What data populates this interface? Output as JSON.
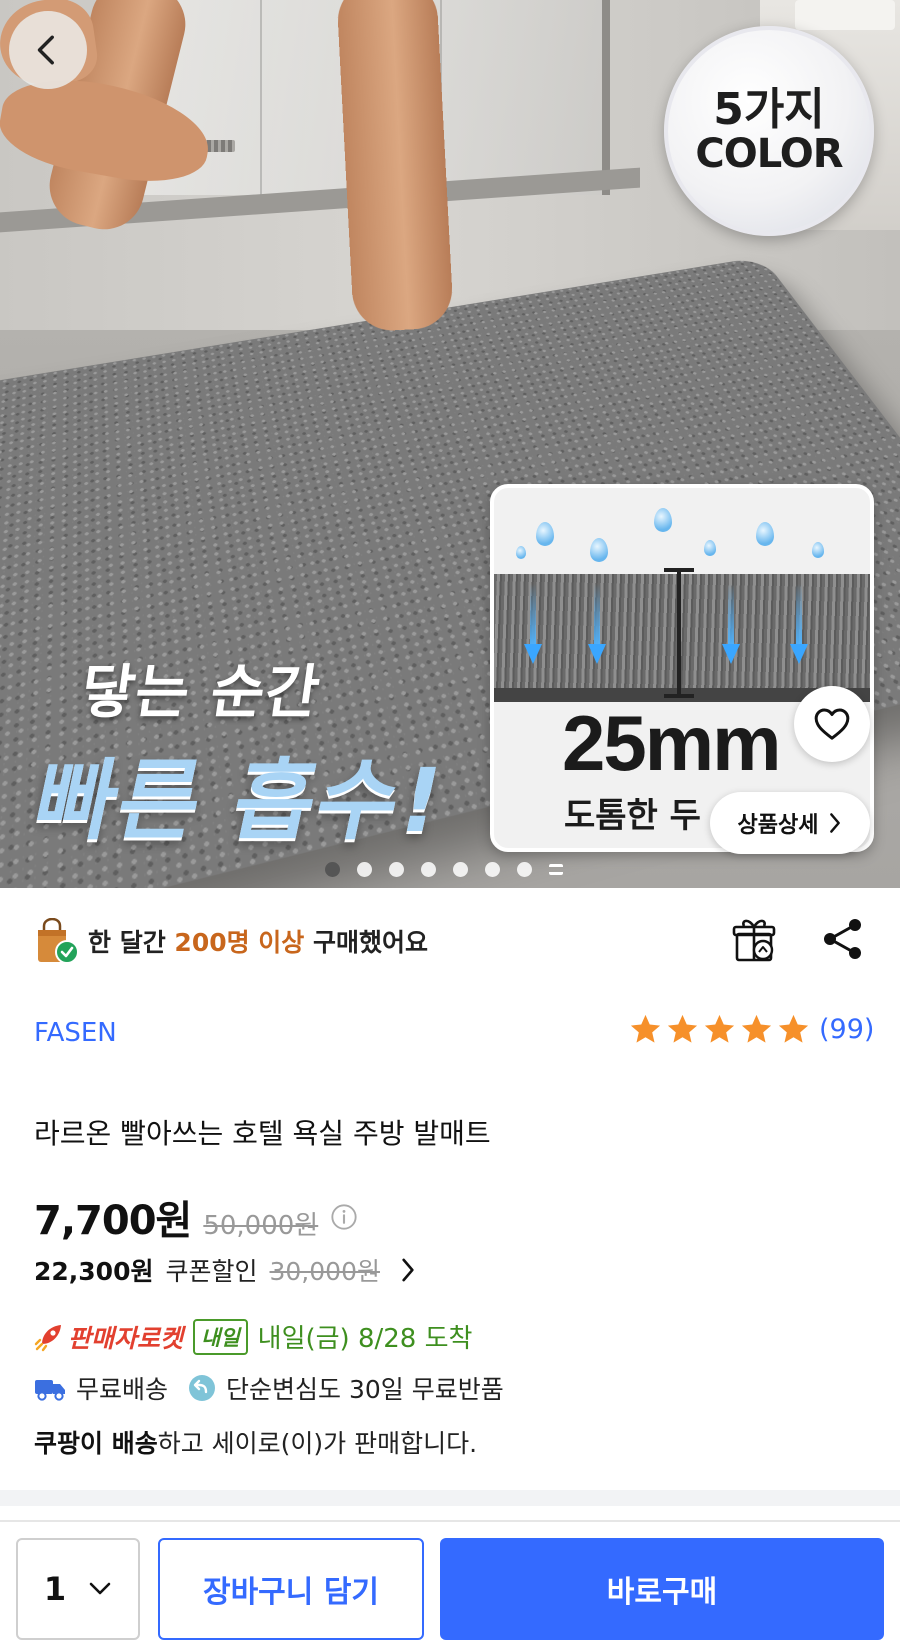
{
  "hero": {
    "badge_line1": "5가지",
    "badge_line2": "COLOR",
    "promo_line1": "닿는 순간",
    "promo_line2": "빠른 흡수!",
    "inset_value": "25mm",
    "inset_caption": "도톰한 두",
    "detail_label": "상품상세",
    "carousel": {
      "total_dots": 7,
      "active_index": 0
    }
  },
  "social_proof": {
    "prefix": "한 달간 ",
    "highlight": "200명 이상",
    "suffix": " 구매했어요"
  },
  "product": {
    "brand": "FASEN",
    "rating_stars": 5,
    "review_count": "(99)",
    "title": "라르온 빨아쓰는 호텔 욕실 주방 발매트",
    "price": "7,700원",
    "original_price": "50,000원",
    "coupon_price": "22,300원",
    "coupon_label": "쿠폰할인",
    "coupon_original": "30,000원"
  },
  "delivery": {
    "rocket_label": "판매자로켓",
    "tomorrow_badge": "내일",
    "arrival": "내일(금) 8/28 도착",
    "free_shipping": "무료배송",
    "free_return": "단순변심도 30일 무료반품",
    "seller_bold": "쿠팡이 배송",
    "seller_rest": "하고 세이로(이)가 판매합니다."
  },
  "bottom_bar": {
    "quantity": "1",
    "cart_label": "장바구니 담기",
    "buy_label": "바로구매"
  },
  "colors": {
    "accent": "#346aff",
    "highlight_orange": "#c8661c",
    "rocket_red": "#e2402f",
    "arrival_green": "#3e8f1f",
    "star": "#f6902a"
  },
  "icons": [
    "back-arrow-icon",
    "heart-icon",
    "chevron-right-icon",
    "shopping-bag-check-icon",
    "gift-icon",
    "share-icon",
    "star-icon",
    "info-icon",
    "rocket-icon",
    "truck-icon",
    "return-icon",
    "chevron-down-icon"
  ]
}
